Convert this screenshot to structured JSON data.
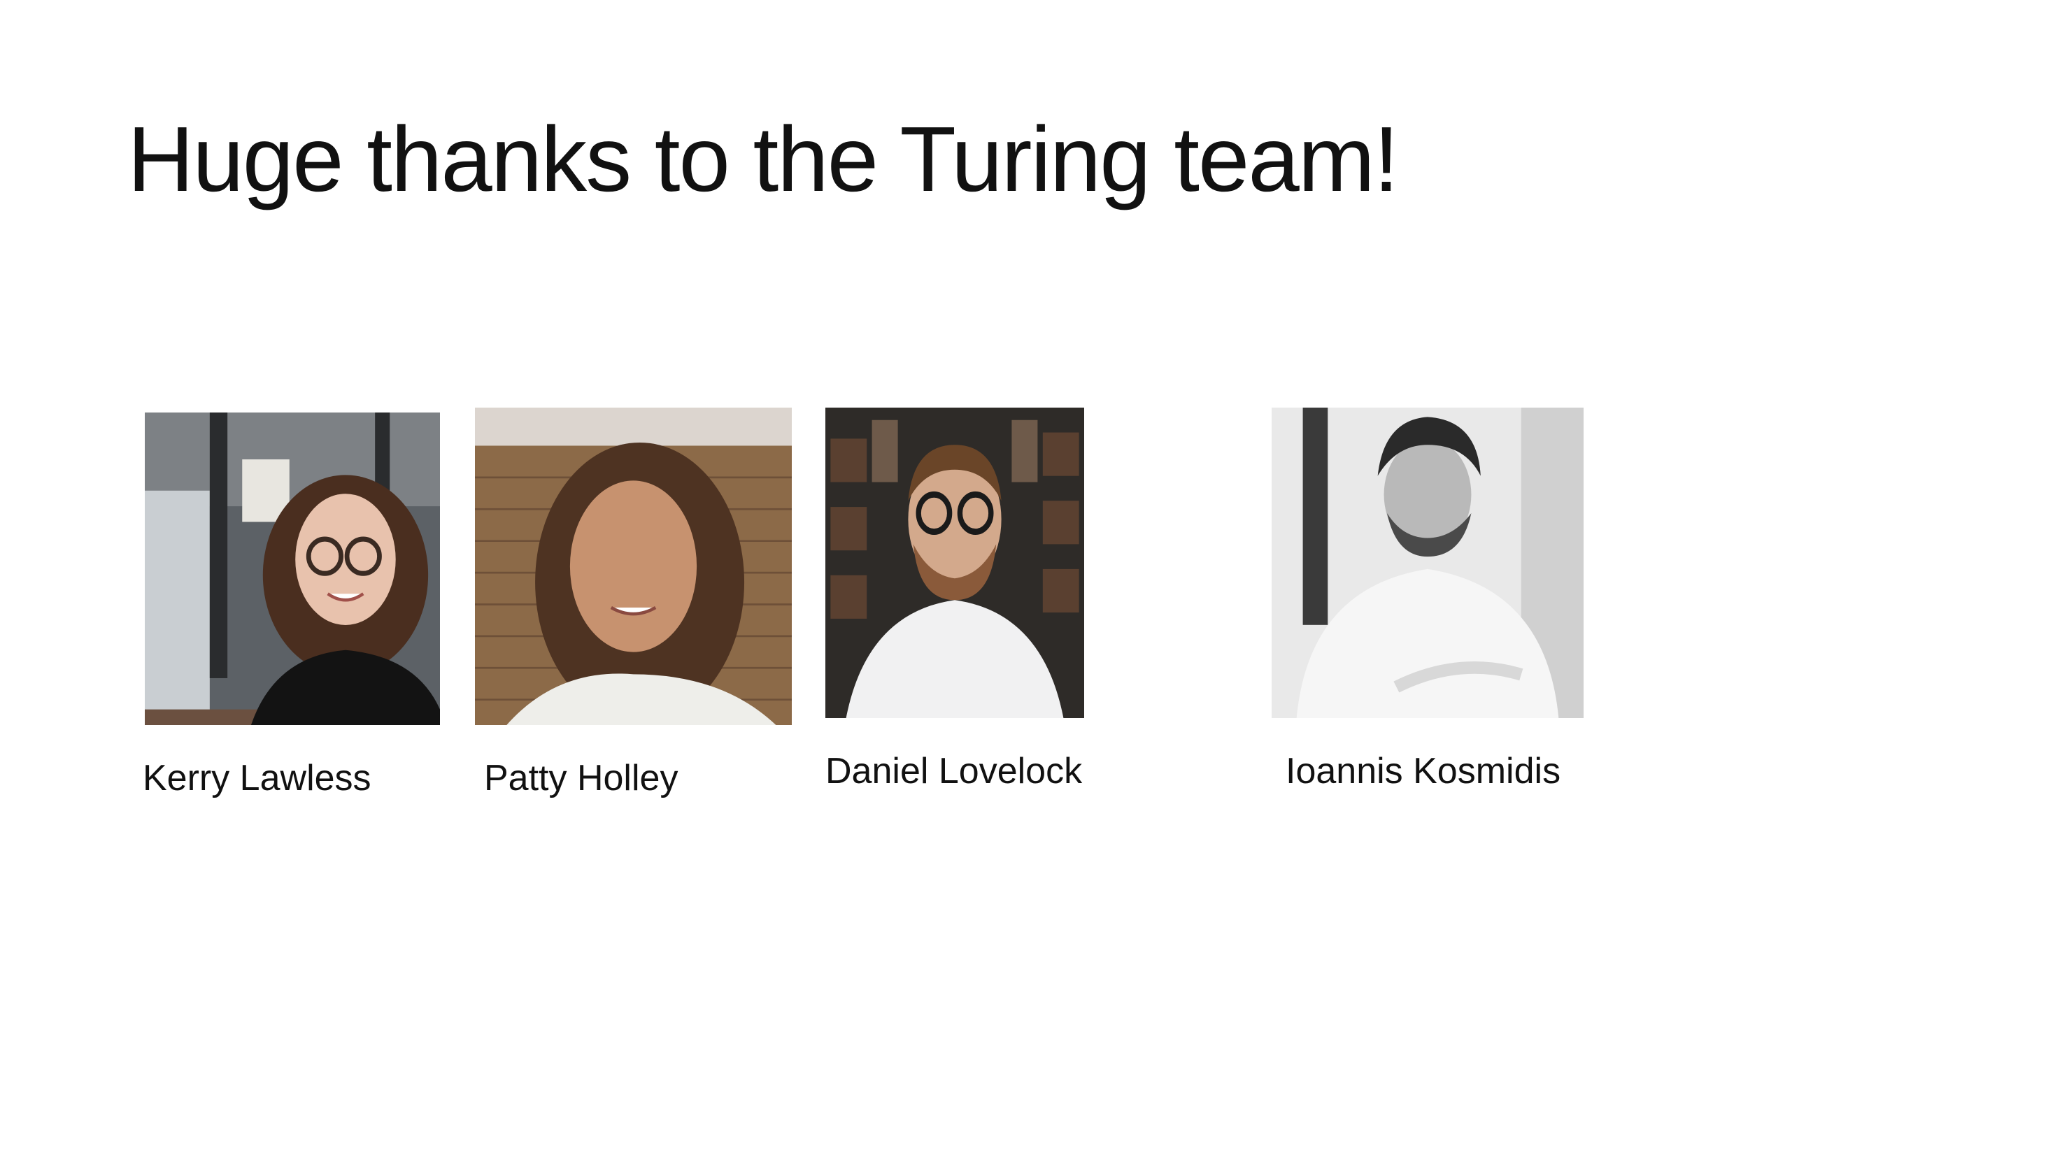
{
  "slide": {
    "title": "Huge thanks to the Turing team!"
  },
  "team": [
    {
      "name": "Kerry Lawless",
      "photo_icon": "portrait-photo"
    },
    {
      "name": "Patty Holley",
      "photo_icon": "portrait-photo"
    },
    {
      "name": "Daniel Lovelock",
      "photo_icon": "portrait-photo"
    },
    {
      "name": "Ioannis Kosmidis",
      "photo_icon": "portrait-photo"
    }
  ],
  "colors": {
    "background": "#ffffff",
    "text": "#111111"
  }
}
